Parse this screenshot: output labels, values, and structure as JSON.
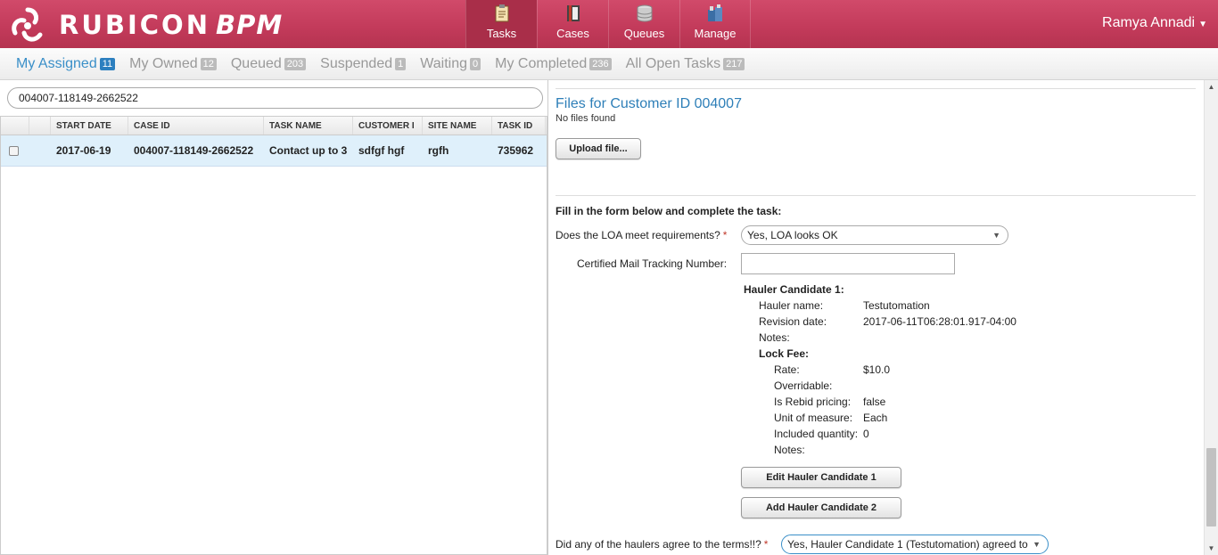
{
  "brand": {
    "name": "RUBICON",
    "suffix": "BPM",
    "color": "#c23a5a"
  },
  "nav": [
    {
      "label": "Tasks",
      "icon": "clipboard-icon",
      "active": true
    },
    {
      "label": "Cases",
      "icon": "book-icon",
      "active": false
    },
    {
      "label": "Queues",
      "icon": "database-icon",
      "active": false
    },
    {
      "label": "Manage",
      "icon": "tools-icon",
      "active": false
    }
  ],
  "user": {
    "name": "Ramya Annadi"
  },
  "tabs": [
    {
      "label": "My Assigned",
      "count": "11",
      "active": true
    },
    {
      "label": "My Owned",
      "count": "12"
    },
    {
      "label": "Queued",
      "count": "203"
    },
    {
      "label": "Suspended",
      "count": "1"
    },
    {
      "label": "Waiting",
      "count": "0"
    },
    {
      "label": "My Completed",
      "count": "236"
    },
    {
      "label": "All Open Tasks",
      "count": "217"
    }
  ],
  "search": {
    "value": "004007-118149-2662522"
  },
  "grid": {
    "columns": [
      "START DATE",
      "CASE ID",
      "TASK NAME",
      "CUSTOMER I",
      "SITE NAME",
      "TASK ID"
    ],
    "rows": [
      {
        "start_date": "2017-06-19",
        "case_id": "004007-118149-2662522",
        "task_name": "Contact up to 3",
        "customer": "sdfgf hgf",
        "site_name": "rgfh",
        "task_id": "735962"
      }
    ]
  },
  "files": {
    "title": "Files for Customer ID 004007",
    "empty": "No files found",
    "upload_label": "Upload file..."
  },
  "form": {
    "intro": "Fill in the form below and complete the task:",
    "loa_label": "Does the LOA meet requirements?",
    "loa_value": "Yes, LOA looks OK",
    "required_mark": "*",
    "tracking_label": "Certified Mail Tracking Number:",
    "tracking_value": "",
    "hauler": {
      "heading": "Hauler Candidate 1:",
      "name_label": "Hauler name:",
      "name_value": "Testutomation",
      "revision_label": "Revision date:",
      "revision_value": "2017-06-11T06:28:01.917-04:00",
      "notes_label": "Notes:",
      "lockfee_heading": "Lock Fee:",
      "rate_label": "Rate:",
      "rate_value": "$10.0",
      "overridable_label": "Overridable:",
      "rebid_label": "Is Rebid pricing:",
      "rebid_value": "false",
      "uom_label": "Unit of measure:",
      "uom_value": "Each",
      "qty_label": "Included quantity:",
      "qty_value": "0",
      "notes2_label": "Notes:"
    },
    "edit_label": "Edit Hauler Candidate 1",
    "add_label": "Add Hauler Candidate 2",
    "agree_label": "Did any of the haulers agree to the terms!!?",
    "agree_value": "Yes, Hauler Candidate 1 (Testutomation) agreed to"
  }
}
